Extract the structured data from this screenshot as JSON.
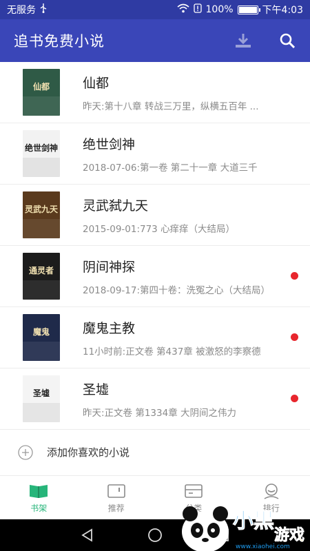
{
  "status_bar": {
    "carrier": "无服务",
    "battery": "100%",
    "battery_level": 1.0,
    "time": "下午4:03"
  },
  "app_bar": {
    "title": "追书免费小说",
    "download_icon": "download-icon",
    "search_icon": "search-icon"
  },
  "books": [
    {
      "title": "仙都",
      "subtitle": "昨天:第十八章 转战三万里，纵横五百年 ...",
      "has_update": false,
      "cover_color": "#2f5a46",
      "cover_text": "仙都"
    },
    {
      "title": "绝世剑神",
      "subtitle": "2018-07-06:第一卷 第二十一章 大道三千",
      "has_update": false,
      "cover_color": "#f2f2f2",
      "cover_text": "绝世剑神"
    },
    {
      "title": "灵武弑九天",
      "subtitle": "2015-09-01:773 心痒痒（大结局）",
      "has_update": false,
      "cover_color": "#5a3a1d",
      "cover_text": "灵武九天"
    },
    {
      "title": "阴间神探",
      "subtitle": "2018-09-17:第四十卷：洗冤之心（大结局）",
      "has_update": true,
      "cover_color": "#1c1c1c",
      "cover_text": "通灵者"
    },
    {
      "title": "魔鬼主教",
      "subtitle": "11小时前:正文卷 第437章 被激怒的李察德",
      "has_update": true,
      "cover_color": "#1f2a4a",
      "cover_text": "魔鬼"
    },
    {
      "title": "圣墟",
      "subtitle": "昨天:正文卷 第1334章 大阴间之伟力",
      "has_update": true,
      "cover_color": "#f4f4f4",
      "cover_text": "圣墟"
    }
  ],
  "add_row": {
    "label": "添加你喜欢的小说",
    "icon": "plus-circle-icon"
  },
  "bottom_nav": [
    {
      "label": "书架",
      "icon": "bookshelf-icon",
      "active": true
    },
    {
      "label": "推荐",
      "icon": "recommend-icon",
      "active": false
    },
    {
      "label": "分类",
      "icon": "category-icon",
      "active": false
    },
    {
      "label": "排行",
      "icon": "ranking-icon",
      "active": false
    }
  ],
  "watermark": {
    "text": "小黑游戏",
    "url": "www.xiaohei.com"
  },
  "colors": {
    "primary": "#3a46b8",
    "status": "#2f3ba3",
    "accent_green": "#27b57a",
    "new_dot": "#e8262d"
  }
}
